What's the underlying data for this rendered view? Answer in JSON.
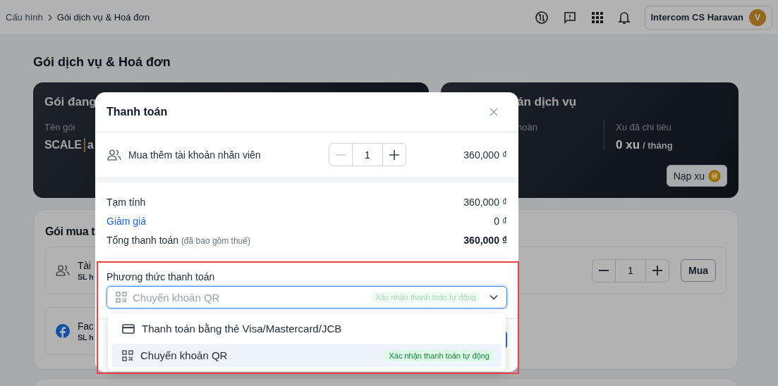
{
  "topbar": {
    "breadcrumb": [
      "Cấu hình",
      "Gói dịch vụ & Hoá đơn"
    ],
    "user": {
      "name": "Intercom CS Haravan",
      "avatar": "V"
    }
  },
  "page_title": "Gói dịch vụ & Hoá đơn",
  "current_plan_card": {
    "title": "Gói đang",
    "field_label": "Tên gói",
    "plan": "SCALE",
    "plan_suffix": "a"
  },
  "service_card": {
    "title": "án dịch vụ",
    "stat_1_label": "hoàn",
    "stat_2_label": "Xu đã chi tiêu",
    "stat_2_value": "0 xu",
    "stat_2_unit": "/ tháng",
    "topup_button": "Nạp xu"
  },
  "purchase_card": {
    "title": "Gói mua t",
    "rows": [
      {
        "kind": "people",
        "name": "Tài",
        "sub": "SL h",
        "quantity": "1",
        "buy": "Mua"
      },
      {
        "kind": "facebook",
        "name": "Fac",
        "sub": "SL h"
      }
    ]
  },
  "modal": {
    "title": "Thanh toán",
    "item": {
      "label": "Mua thêm tài khoản nhân viên",
      "quantity": "1",
      "minus_disabled": true,
      "price": "360,000 ₫"
    },
    "summary": [
      {
        "kind": "plain",
        "label": "Tạm tính",
        "value": "360,000 ₫"
      },
      {
        "kind": "link",
        "label": "Giảm giá",
        "value": "0 ₫"
      },
      {
        "kind": "total",
        "label": "Tổng thanh toán",
        "note": "(đã bao gồm thuế)",
        "value": "360,000 ₫"
      }
    ],
    "payment": {
      "label": "Phương thức thanh toán",
      "placeholder": "Chuyển khoản QR",
      "tag": "Xác nhận thanh toán tự động",
      "options": [
        {
          "kind": "card",
          "label": "Thanh toán bằng thẻ Visa/Mastercard/JCB",
          "selected": false
        },
        {
          "kind": "qr",
          "label": "Chuyển khoản QR",
          "tag": "Xác nhận thanh toán tự động",
          "selected": true
        }
      ]
    }
  }
}
